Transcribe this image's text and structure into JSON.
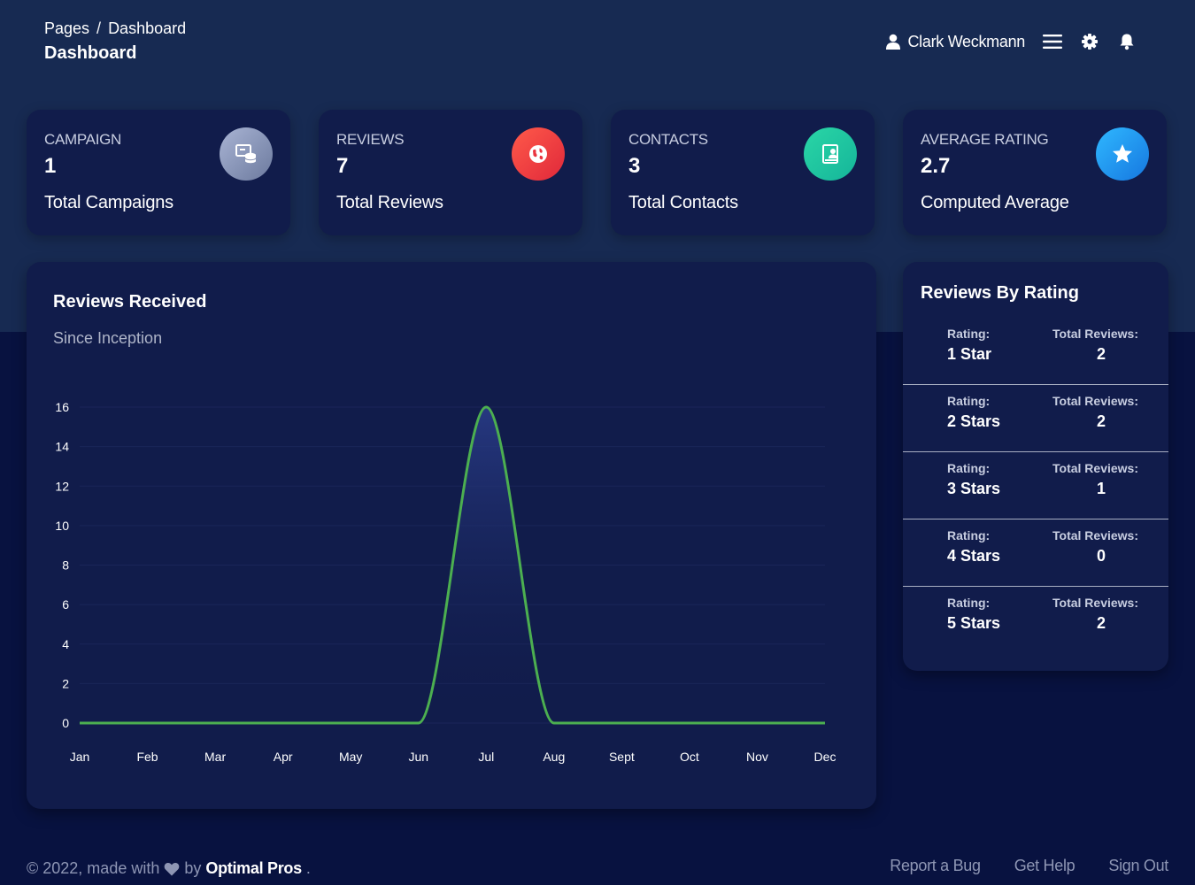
{
  "header": {
    "breadcrumb": [
      "Pages",
      "/",
      "Dashboard"
    ],
    "title": "Dashboard",
    "user_name": "Clark Weckmann"
  },
  "stats": [
    {
      "label": "CAMPAIGN",
      "value": "1",
      "desc": "Total Campaigns",
      "icon": "campaign-icon",
      "color": "#8a96b8"
    },
    {
      "label": "REVIEWS",
      "value": "7",
      "desc": "Total Reviews",
      "icon": "globe-icon",
      "color": "#f0403d"
    },
    {
      "label": "CONTACTS",
      "value": "3",
      "desc": "Total Contacts",
      "icon": "contact-book-icon",
      "color": "#1cc4a0"
    },
    {
      "label": "AVERAGE RATING",
      "value": "2.7",
      "desc": "Computed Average",
      "icon": "star-icon",
      "color": "#1e9bf0"
    }
  ],
  "reviews_chart": {
    "title": "Reviews Received",
    "subtitle": "Since Inception"
  },
  "chart_data": {
    "type": "area",
    "categories": [
      "Jan",
      "Feb",
      "Mar",
      "Apr",
      "May",
      "Jun",
      "Jul",
      "Aug",
      "Sept",
      "Oct",
      "Nov",
      "Dec"
    ],
    "values": [
      0,
      0,
      0,
      0,
      0,
      0,
      16,
      0,
      0,
      0,
      0,
      0
    ],
    "yticks": [
      "0",
      "2",
      "4",
      "6",
      "8",
      "10",
      "12",
      "14",
      "16"
    ],
    "ylim": [
      0,
      16
    ],
    "line_color": "#4caf50",
    "grid": true
  },
  "ratings": {
    "title": "Reviews By Rating",
    "rating_label": "Rating:",
    "total_label": "Total Reviews:",
    "rows": [
      {
        "rating": "1 Star",
        "total": "2"
      },
      {
        "rating": "2 Stars",
        "total": "2"
      },
      {
        "rating": "3 Stars",
        "total": "1"
      },
      {
        "rating": "4 Stars",
        "total": "0"
      },
      {
        "rating": "5 Stars",
        "total": "2"
      }
    ]
  },
  "footer": {
    "copyright": "© 2022, made with",
    "by": "by",
    "brand": "Optimal Pros",
    "period": ".",
    "links": [
      "Report a Bug",
      "Get Help",
      "Sign Out"
    ]
  }
}
